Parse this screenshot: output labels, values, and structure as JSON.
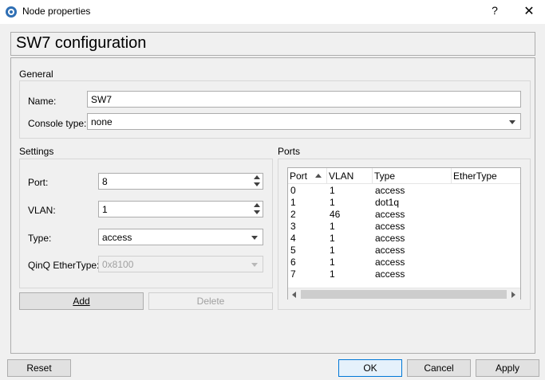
{
  "window": {
    "title": "Node properties",
    "help_glyph": "?",
    "close_glyph": "✕"
  },
  "header": {
    "title": "SW7 configuration"
  },
  "general": {
    "label": "General",
    "name_label": "Name:",
    "name_value": "SW7",
    "console_label": "Console type:",
    "console_value": "none"
  },
  "settings": {
    "label": "Settings",
    "port_label": "Port:",
    "port_value": "8",
    "vlan_label": "VLAN:",
    "vlan_value": "1",
    "type_label": "Type:",
    "type_value": "access",
    "qinq_label": "QinQ EtherType:",
    "qinq_value": "0x8100",
    "add_button": "Add",
    "delete_button": "Delete"
  },
  "ports": {
    "label": "Ports",
    "columns": [
      "Port",
      "VLAN",
      "Type",
      "EtherType"
    ],
    "rows": [
      [
        "0",
        "1",
        "access",
        ""
      ],
      [
        "1",
        "1",
        "dot1q",
        ""
      ],
      [
        "2",
        "46",
        "access",
        ""
      ],
      [
        "3",
        "1",
        "access",
        ""
      ],
      [
        "4",
        "1",
        "access",
        ""
      ],
      [
        "5",
        "1",
        "access",
        ""
      ],
      [
        "6",
        "1",
        "access",
        ""
      ],
      [
        "7",
        "1",
        "access",
        ""
      ]
    ]
  },
  "footer": {
    "reset": "Reset",
    "ok": "OK",
    "cancel": "Cancel",
    "apply": "Apply"
  },
  "icons": {
    "app": "gns3-node-icon",
    "sort": "sort-ascending-icon"
  },
  "colors": {
    "titlebar": "#ffffff",
    "background": "#f0f0f0",
    "default_button_border": "#0078d7"
  }
}
